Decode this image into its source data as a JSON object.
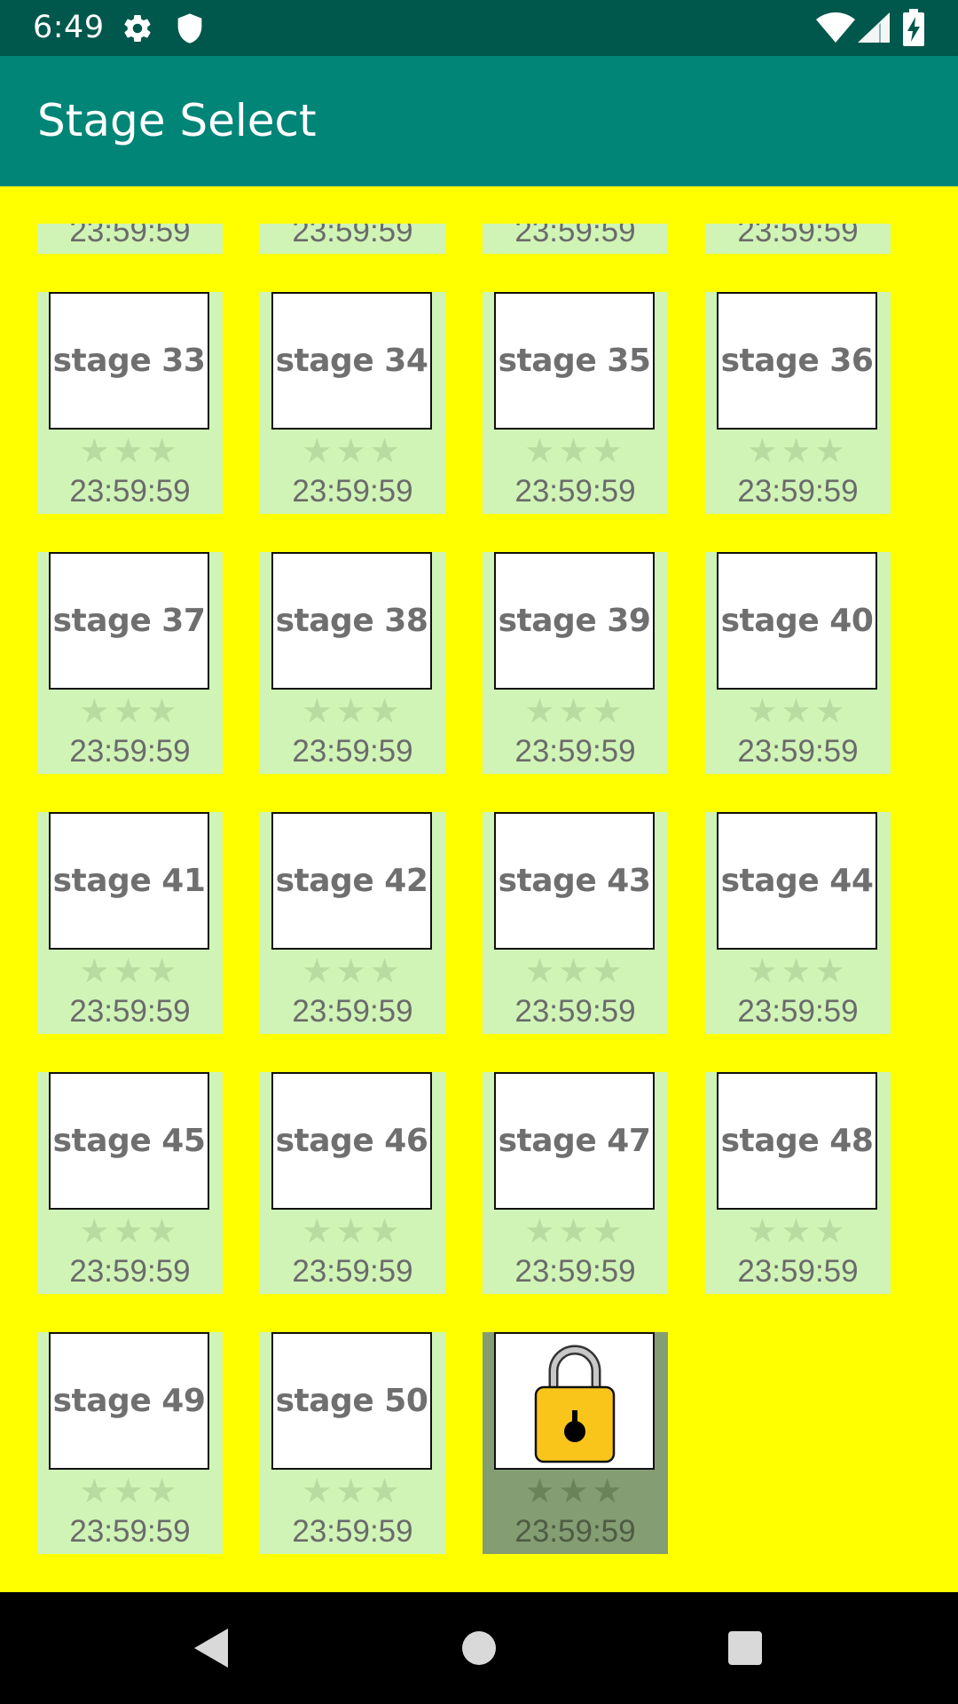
{
  "status_bar": {
    "time": "6:49",
    "icons": [
      "gear-icon",
      "shield-icon",
      "wifi-icon",
      "signal-icon",
      "battery-charging-icon"
    ]
  },
  "app_bar": {
    "title": "Stage Select"
  },
  "colors": {
    "status_bar": "#00574b",
    "app_bar": "#008577",
    "background": "#ffff00",
    "cell": "#cff4b6",
    "cell_locked": "#859d73",
    "lock_body": "#f9c51b"
  },
  "partial_row": {
    "times": [
      "23:59:59",
      "23:59:59",
      "23:59:59",
      "23:59:59"
    ]
  },
  "stages": [
    {
      "label": "stage 33",
      "stars": "★★★",
      "time": "23:59:59",
      "locked": false
    },
    {
      "label": "stage 34",
      "stars": "★★★",
      "time": "23:59:59",
      "locked": false
    },
    {
      "label": "stage 35",
      "stars": "★★★",
      "time": "23:59:59",
      "locked": false
    },
    {
      "label": "stage 36",
      "stars": "★★★",
      "time": "23:59:59",
      "locked": false
    },
    {
      "label": "stage 37",
      "stars": "★★★",
      "time": "23:59:59",
      "locked": false
    },
    {
      "label": "stage 38",
      "stars": "★★★",
      "time": "23:59:59",
      "locked": false
    },
    {
      "label": "stage 39",
      "stars": "★★★",
      "time": "23:59:59",
      "locked": false
    },
    {
      "label": "stage 40",
      "stars": "★★★",
      "time": "23:59:59",
      "locked": false
    },
    {
      "label": "stage 41",
      "stars": "★★★",
      "time": "23:59:59",
      "locked": false
    },
    {
      "label": "stage 42",
      "stars": "★★★",
      "time": "23:59:59",
      "locked": false
    },
    {
      "label": "stage 43",
      "stars": "★★★",
      "time": "23:59:59",
      "locked": false
    },
    {
      "label": "stage 44",
      "stars": "★★★",
      "time": "23:59:59",
      "locked": false
    },
    {
      "label": "stage 45",
      "stars": "★★★",
      "time": "23:59:59",
      "locked": false
    },
    {
      "label": "stage 46",
      "stars": "★★★",
      "time": "23:59:59",
      "locked": false
    },
    {
      "label": "stage 47",
      "stars": "★★★",
      "time": "23:59:59",
      "locked": false
    },
    {
      "label": "stage 48",
      "stars": "★★★",
      "time": "23:59:59",
      "locked": false
    },
    {
      "label": "stage 49",
      "stars": "★★★",
      "time": "23:59:59",
      "locked": false
    },
    {
      "label": "stage 50",
      "stars": "★★★",
      "time": "23:59:59",
      "locked": false
    },
    {
      "label": "",
      "stars": "★★★",
      "time": "23:59:59",
      "locked": true,
      "icon": "padlock-icon"
    }
  ],
  "nav_bar": {
    "buttons": [
      "back-icon",
      "home-icon",
      "recents-icon"
    ]
  }
}
